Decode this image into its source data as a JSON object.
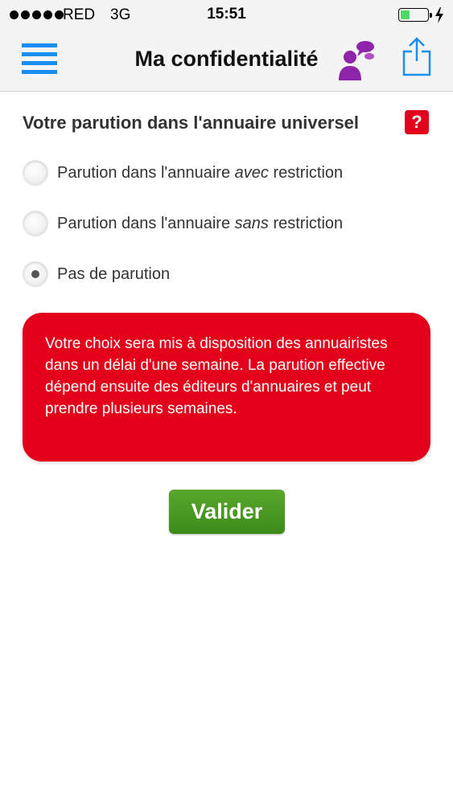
{
  "status_bar": {
    "carrier": "RED",
    "network": "3G",
    "time": "15:51",
    "signal_dots": 5,
    "battery_level_percent": 35,
    "battery_color": "#4cd964"
  },
  "nav": {
    "title": "Ma confidentialité",
    "menu_icon": "hamburger-menu-icon",
    "profile_icon": "person-speech-bubble-icon",
    "share_icon": "share-icon",
    "accent_color": "#1a8ef0",
    "profile_icon_color": "#8e24aa"
  },
  "section": {
    "title": "Votre parution dans l'annuaire universel",
    "help_label": "?",
    "help_color": "#e2001a"
  },
  "options": [
    {
      "prefix": "Parution dans l'annuaire ",
      "emphasis": "avec",
      "suffix": " restriction",
      "checked": false
    },
    {
      "prefix": "Parution dans l'annuaire ",
      "emphasis": "sans",
      "suffix": " restriction",
      "checked": false
    },
    {
      "prefix": "Pas de parution",
      "emphasis": "",
      "suffix": "",
      "checked": true
    }
  ],
  "notice": {
    "text": "Votre choix sera mis à disposition des annuairistes dans un délai d'une semaine. La parution effective dépend ensuite des éditeurs d'annuaires et peut prendre plusieurs semaines.",
    "background_color": "#e2001a"
  },
  "validate_button": {
    "label": "Valider",
    "color": "#4a9a24"
  }
}
